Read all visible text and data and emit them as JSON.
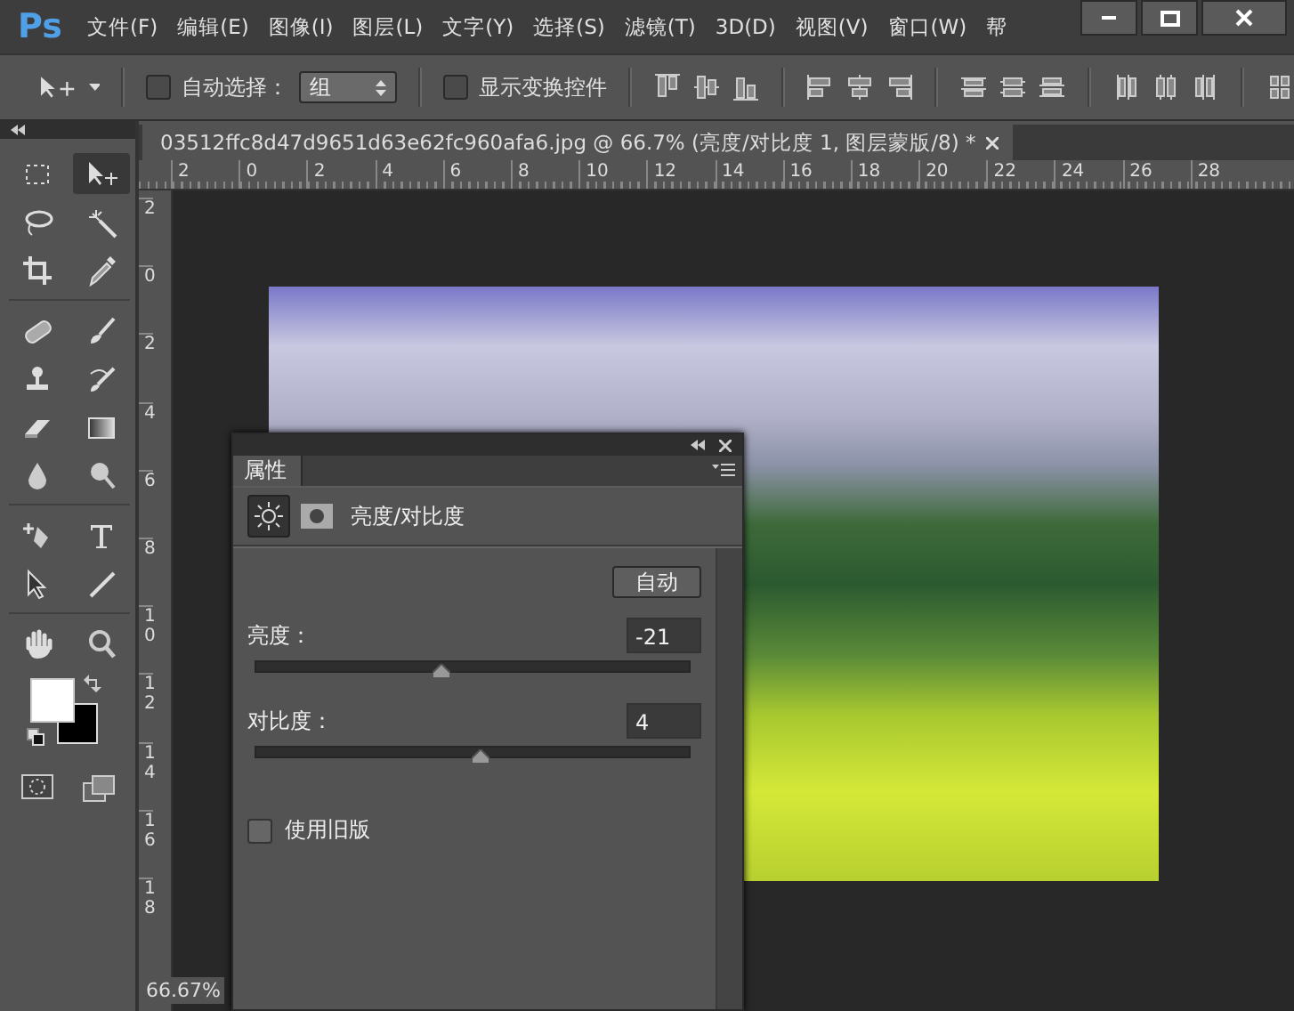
{
  "app": {
    "logo": "Ps"
  },
  "menu": [
    {
      "label": "文件(F)"
    },
    {
      "label": "编辑(E)"
    },
    {
      "label": "图像(I)"
    },
    {
      "label": "图层(L)"
    },
    {
      "label": "文字(Y)"
    },
    {
      "label": "选择(S)"
    },
    {
      "label": "滤镜(T)"
    },
    {
      "label": "3D(D)"
    },
    {
      "label": "视图(V)"
    },
    {
      "label": "窗口(W)"
    },
    {
      "label": "帮"
    }
  ],
  "options_bar": {
    "auto_select": {
      "label": "自动选择：",
      "checked": false
    },
    "auto_select_target": {
      "value": "组"
    },
    "show_transform": {
      "label": "显示变换控件",
      "checked": false
    }
  },
  "tools": [
    {
      "kind": "marquee",
      "selected": false
    },
    {
      "kind": "move",
      "selected": true
    },
    {
      "kind": "lasso",
      "selected": false
    },
    {
      "kind": "wand",
      "selected": false
    },
    {
      "kind": "crop",
      "selected": false
    },
    {
      "kind": "eyedropper",
      "selected": false
    },
    {
      "kind": "healing",
      "selected": false
    },
    {
      "kind": "brush",
      "selected": false
    },
    {
      "kind": "stamp",
      "selected": false
    },
    {
      "kind": "history",
      "selected": false
    },
    {
      "kind": "eraser",
      "selected": false
    },
    {
      "kind": "gradient",
      "selected": false
    },
    {
      "kind": "blur",
      "selected": false
    },
    {
      "kind": "dodge",
      "selected": false
    },
    {
      "kind": "pen",
      "selected": false
    },
    {
      "kind": "type",
      "selected": false
    },
    {
      "kind": "pathselect",
      "selected": false
    },
    {
      "kind": "line",
      "selected": false
    },
    {
      "kind": "hand",
      "selected": false
    },
    {
      "kind": "zoom",
      "selected": false
    }
  ],
  "document": {
    "tab_title": "03512ffc8d47d9651d63e62fc960afa6.jpg @ 66.7% (亮度/对比度 1, 图层蒙版/8) *",
    "ruler_h": [
      "2",
      "0",
      "2",
      "4",
      "6",
      "8",
      "10",
      "12",
      "14",
      "16",
      "18",
      "20",
      "22",
      "24",
      "26",
      "28"
    ],
    "ruler_v": [
      "2",
      "0",
      "2",
      "4",
      "6",
      "8",
      "10",
      "12",
      "14",
      "16",
      "18"
    ],
    "zoom": "66.67%"
  },
  "properties": {
    "tab": "属性",
    "title": "亮度/对比度",
    "auto_button": "自动",
    "sliders": [
      {
        "label": "亮度：",
        "value": "-21",
        "level": 0.43
      },
      {
        "label": "对比度：",
        "value": "4",
        "level": 0.52
      }
    ],
    "legacy": {
      "label": "使用旧版",
      "checked": false
    }
  }
}
